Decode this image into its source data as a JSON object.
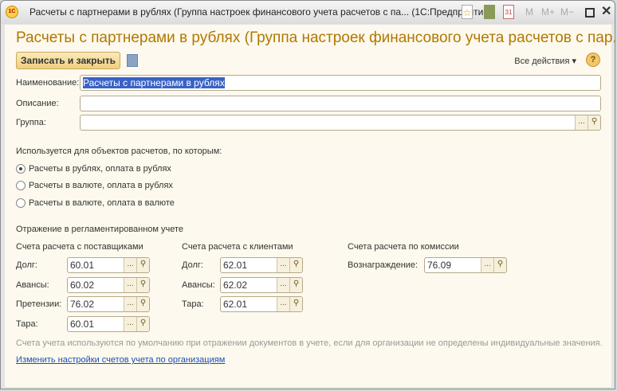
{
  "window": {
    "title": "Расчеты с партнерами в рублях (Группа настроек финансового учета расчетов с па...  (1С:Предприятие)",
    "logo": "1С",
    "toolbar": [
      "favorite-icon",
      "calculator-icon",
      "calendar-icon",
      "М",
      "М+",
      "М−",
      "maximize-icon",
      "close-icon"
    ]
  },
  "form": {
    "title": "Расчеты с партнерами в рублях (Группа настроек финансового учета расчетов с пар...",
    "save_close": "Записать и закрыть",
    "all_actions": "Все действия ▾",
    "help": "?",
    "name_label": "Наименование:",
    "name_value": "Расчеты с партнерами в рублях",
    "desc_label": "Описание:",
    "desc_value": "",
    "group_label": "Группа:",
    "group_value": "",
    "used_label": "Используется для объектов расчетов, по которым:",
    "radios": [
      {
        "label": "Расчеты в рублях, оплата в рублях",
        "checked": true
      },
      {
        "label": "Расчеты в валюте, оплата в рублях",
        "checked": false
      },
      {
        "label": "Расчеты в валюте, оплата в валюте",
        "checked": false
      }
    ],
    "reg_label": "Отражение в регламентированном учете",
    "suppliers": {
      "header": "Счета расчета с поставщиками",
      "rows": [
        {
          "label": "Долг:",
          "value": "60.01"
        },
        {
          "label": "Авансы:",
          "value": "60.02"
        },
        {
          "label": "Претензии:",
          "value": "76.02"
        },
        {
          "label": "Тара:",
          "value": "60.01"
        }
      ]
    },
    "clients": {
      "header": "Счета расчета с клиентами",
      "rows": [
        {
          "label": "Долг:",
          "value": "62.01"
        },
        {
          "label": "Авансы:",
          "value": "62.02"
        },
        {
          "label": "Тара:",
          "value": "62.01"
        }
      ]
    },
    "commission": {
      "header": "Счета расчета по комиссии",
      "rows": [
        {
          "label": "Вознаграждение:",
          "value": "76.09"
        }
      ]
    },
    "note": "Счета учета используются по умолчанию при отражении документов в учете, если для организации не определены индивидуальные значения.",
    "link": "Изменить настройки счетов учета по организациям",
    "dots": "...",
    "mag": "⚲"
  }
}
